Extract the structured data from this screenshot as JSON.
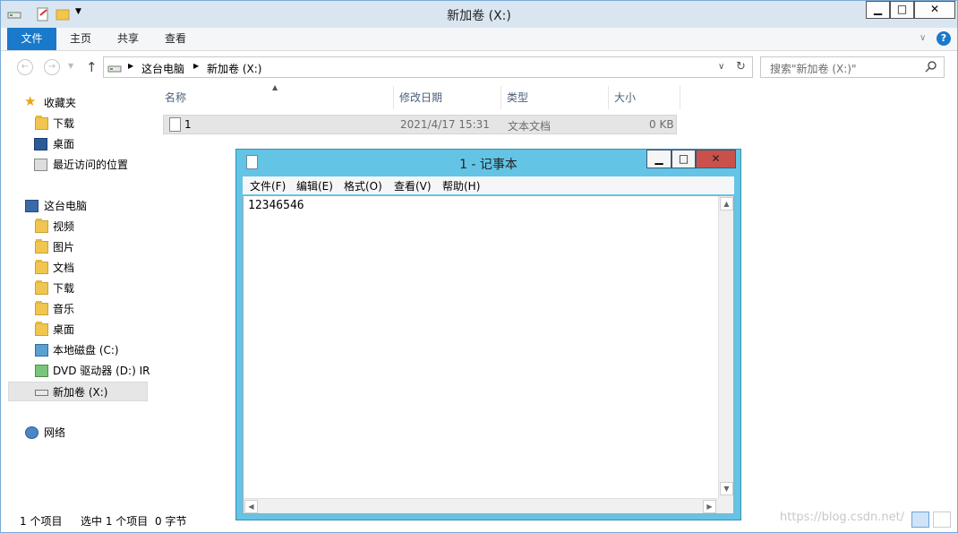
{
  "explorer": {
    "title": "新加卷 (X:)",
    "window_controls": {
      "minimize": "▁",
      "maximize": "□",
      "close": "✕"
    },
    "ribbon_tabs": [
      "文件",
      "主页",
      "共享",
      "查看"
    ],
    "address": {
      "crumb1": "这台电脑",
      "crumb2": "新加卷 (X:)"
    },
    "search_placeholder": "搜索\"新加卷 (X:)\"",
    "nav": {
      "favorites": "收藏夹",
      "fav_items": [
        "下载",
        "桌面",
        "最近访问的位置"
      ],
      "this_pc": "这台电脑",
      "pc_items": [
        "视频",
        "图片",
        "文档",
        "下载",
        "音乐",
        "桌面",
        "本地磁盘 (C:)",
        "DVD 驱动器 (D:) IR",
        "新加卷 (X:)"
      ],
      "network": "网络"
    },
    "columns": [
      "名称",
      "修改日期",
      "类型",
      "大小"
    ],
    "files": [
      {
        "name": "1",
        "modified": "2021/4/17 15:31",
        "type": "文本文档",
        "size": "0 KB"
      }
    ],
    "status": {
      "count": "1 个项目",
      "selected": "选中 1 个项目",
      "bytes": "0 字节"
    }
  },
  "notepad": {
    "title": "1 - 记事本",
    "menu": [
      "文件(F)",
      "编辑(E)",
      "格式(O)",
      "查看(V)",
      "帮助(H)"
    ],
    "content": "12346546",
    "window_controls": {
      "minimize": "▁",
      "maximize": "□",
      "close": "✕"
    }
  },
  "watermark": "https://blog.csdn.net/"
}
